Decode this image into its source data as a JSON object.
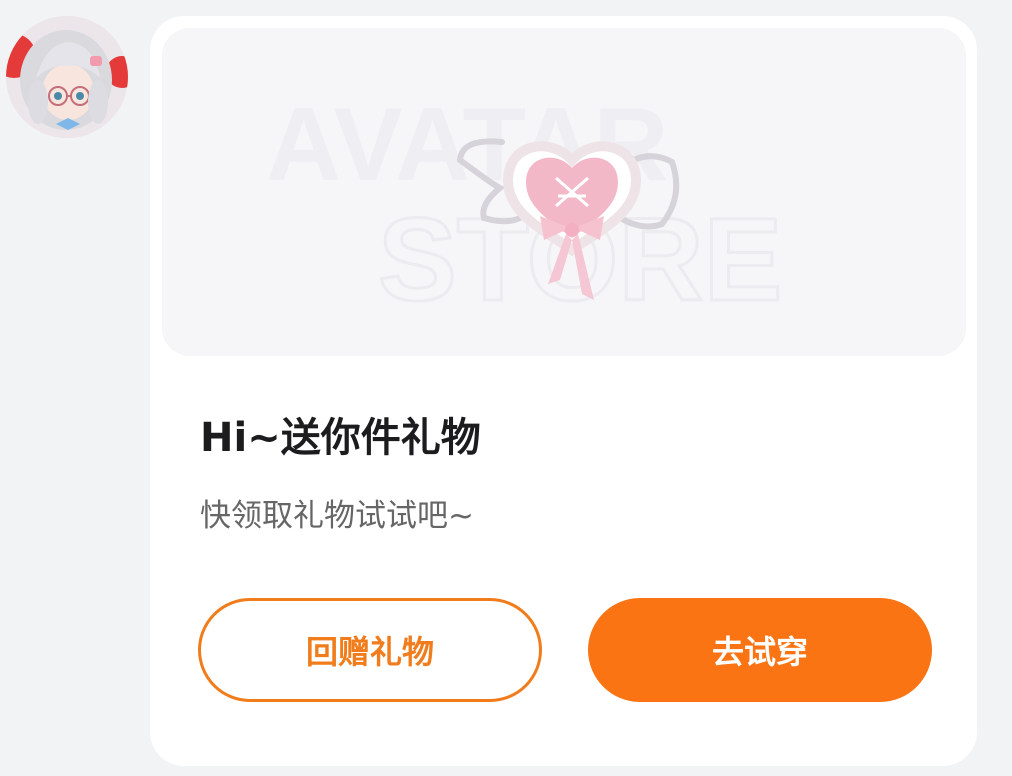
{
  "avatar": {
    "icon": "user-avatar-icon"
  },
  "banner": {
    "watermark_line1": "AVATAR",
    "watermark_line2": "STORE",
    "item_icon": "heart-bow-accessory-icon",
    "colors": {
      "heart": "#f2b8c8",
      "ribbon": "#f6c2cf"
    }
  },
  "card": {
    "title": "Hi~送你件礼物",
    "subtitle": "快领取礼物试试吧~"
  },
  "buttons": {
    "gift_back_label": "回赠礼物",
    "try_on_label": "去试穿"
  },
  "colors": {
    "accent": "#fa7414",
    "outline": "#f07c1c",
    "background": "#f2f3f5"
  }
}
